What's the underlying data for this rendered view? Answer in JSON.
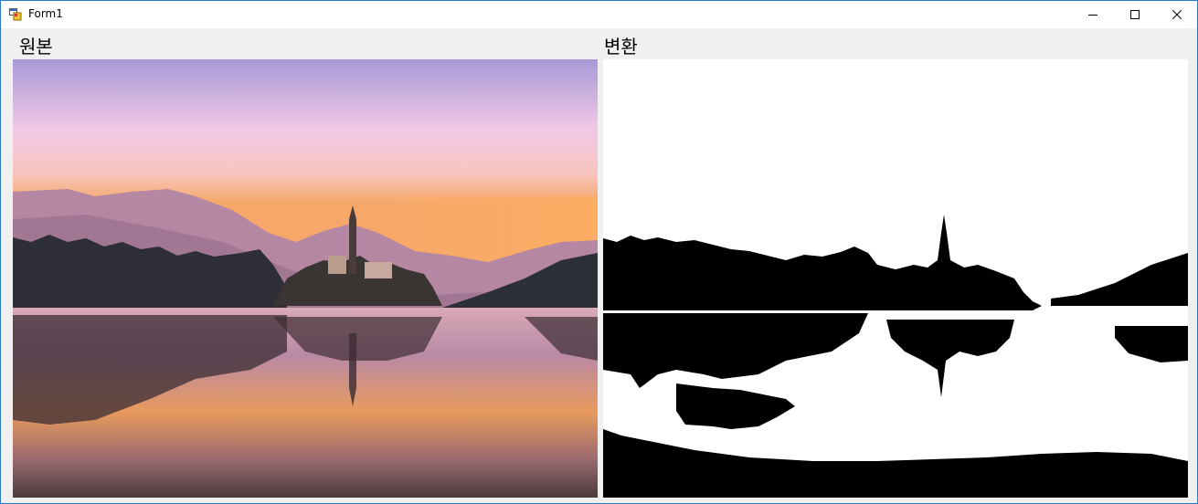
{
  "window": {
    "title": "Form1",
    "icon": "winforms-app-icon",
    "controls": [
      "minimize-icon",
      "maximize-icon",
      "close-icon"
    ]
  },
  "panels": {
    "original_label": "원본",
    "converted_label": "변환"
  },
  "colors": {
    "title_bar": "#ffffff",
    "client_area": "#f0f0f0",
    "window_border": "#2b7bc4"
  }
}
